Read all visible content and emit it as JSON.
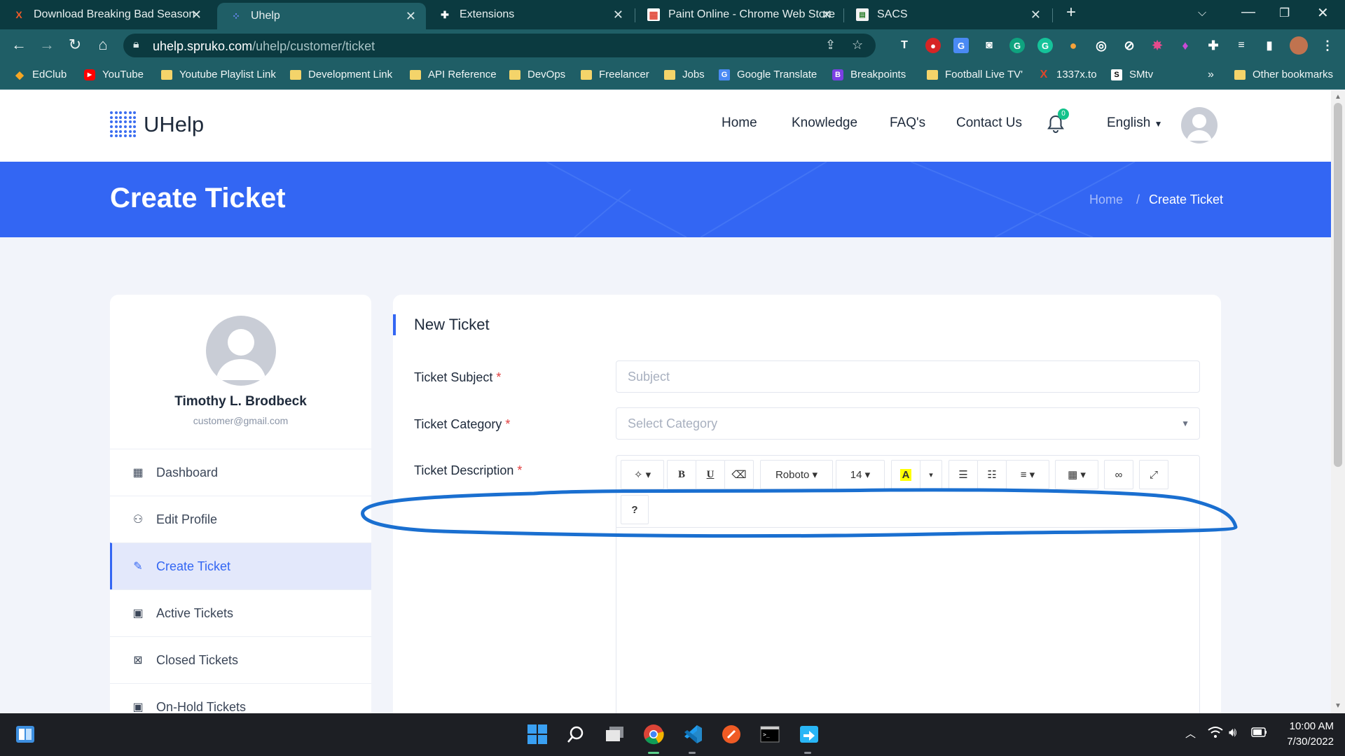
{
  "browser": {
    "tabs": [
      {
        "title": "Download Breaking Bad Season",
        "favicon": "X",
        "active": false
      },
      {
        "title": "Uhelp",
        "favicon": "uhelp-dots",
        "active": true
      },
      {
        "title": "Extensions",
        "favicon": "puzzle",
        "active": false
      },
      {
        "title": "Paint Online - Chrome Web Store",
        "favicon": "paint",
        "active": false
      },
      {
        "title": "SACS",
        "favicon": "sacs",
        "active": false
      }
    ],
    "new_tab": "+",
    "url_host": "uhelp.spruko.com",
    "url_path": "/uhelp/customer/ticket",
    "bookmarks": [
      {
        "label": "EdClub",
        "icon": "edclub"
      },
      {
        "label": "YouTube",
        "icon": "youtube"
      },
      {
        "label": "Youtube Playlist Link",
        "icon": "folder"
      },
      {
        "label": "Development Link",
        "icon": "folder"
      },
      {
        "label": "API Reference",
        "icon": "folder"
      },
      {
        "label": "DevOps",
        "icon": "folder"
      },
      {
        "label": "Freelancer",
        "icon": "folder"
      },
      {
        "label": "Jobs",
        "icon": "folder"
      },
      {
        "label": "Google Translate",
        "icon": "translate"
      },
      {
        "label": "Breakpoints",
        "icon": "bootstrap"
      },
      {
        "label": "Football Live TV'",
        "icon": "folder"
      },
      {
        "label": "1337x.to",
        "icon": "x"
      },
      {
        "label": "SMtv",
        "icon": "s"
      }
    ],
    "bookmarks_more": "»",
    "other_bookmarks": "Other bookmarks"
  },
  "site": {
    "brand": "UHelp",
    "nav": [
      "Home",
      "Knowledge",
      "FAQ's",
      "Contact Us"
    ],
    "notifications_count": "0",
    "language": "English",
    "banner_title": "Create Ticket",
    "breadcrumb": {
      "home": "Home",
      "separator": "/",
      "current": "Create Ticket"
    }
  },
  "profile": {
    "name": "Timothy L. Brodbeck",
    "email": "customer@gmail.com",
    "menu": [
      {
        "label": "Dashboard",
        "icon": "grid-icon",
        "active": false
      },
      {
        "label": "Edit Profile",
        "icon": "user-edit-icon",
        "active": false
      },
      {
        "label": "Create Ticket",
        "icon": "ticket-add-icon",
        "active": true
      },
      {
        "label": "Active Tickets",
        "icon": "ticket-icon",
        "active": false
      },
      {
        "label": "Closed Tickets",
        "icon": "ticket-closed-icon",
        "active": false
      },
      {
        "label": "On-Hold Tickets",
        "icon": "ticket-hold-icon",
        "active": false
      }
    ]
  },
  "form": {
    "title": "New Ticket",
    "subject_label": "Ticket Subject",
    "subject_placeholder": "Subject",
    "category_label": "Ticket Category",
    "category_placeholder": "Select Category",
    "description_label": "Ticket Description",
    "required_mark": "*",
    "editor": {
      "font": "Roboto",
      "size": "14",
      "bold": "B",
      "underline": "U",
      "help": "?"
    }
  },
  "annotation": {
    "color": "#1a6fd0"
  },
  "taskbar": {
    "time": "10:00 AM",
    "date": "7/30/2022"
  },
  "colors": {
    "accent": "#3366f3",
    "chrome_dark": "#0b3a40",
    "chrome": "#1f5e66",
    "required": "#e23e3e"
  }
}
